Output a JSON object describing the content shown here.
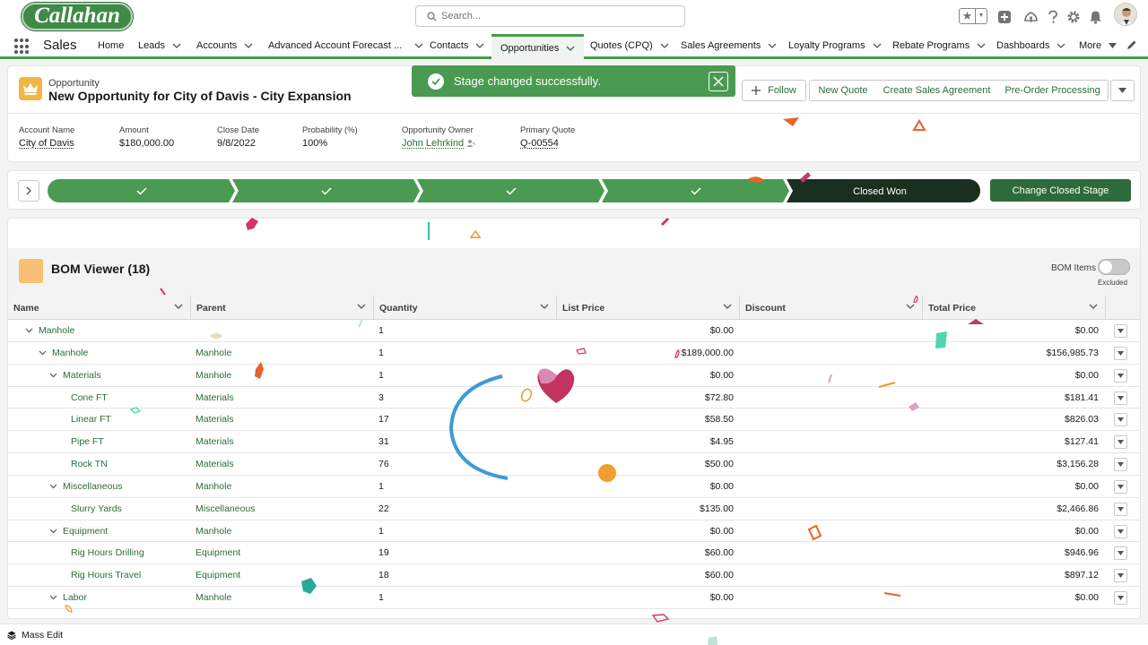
{
  "header": {
    "logo_text": "Callahan",
    "search_placeholder": "Search..."
  },
  "nav": {
    "app_name": "Sales",
    "items": [
      {
        "label": "Home",
        "dropdown": false
      },
      {
        "label": "Leads",
        "dropdown": true
      },
      {
        "label": "Accounts",
        "dropdown": true
      },
      {
        "label": "Advanced Account Forecast ...",
        "dropdown": true
      },
      {
        "label": "Contacts",
        "dropdown": true
      },
      {
        "label": "Opportunities",
        "dropdown": true,
        "active": true
      },
      {
        "label": "Quotes (CPQ)",
        "dropdown": true
      },
      {
        "label": "Sales Agreements",
        "dropdown": true
      },
      {
        "label": "Loyalty Programs",
        "dropdown": true
      },
      {
        "label": "Rebate Programs",
        "dropdown": true
      },
      {
        "label": "Dashboards",
        "dropdown": true
      },
      {
        "label": "More",
        "dropdown": true
      }
    ]
  },
  "record": {
    "object_label": "Opportunity",
    "title": "New Opportunity for City of Davis - City Expansion",
    "actions": {
      "follow": "Follow",
      "new_quote": "New Quote",
      "create_sales_agreement": "Create Sales Agreement",
      "pre_order": "Pre-Order Processing"
    },
    "fields": {
      "account_name": {
        "label": "Account Name",
        "value": "City of Davis"
      },
      "amount": {
        "label": "Amount",
        "value": "$180,000.00"
      },
      "close_date": {
        "label": "Close Date",
        "value": "9/8/2022"
      },
      "probability": {
        "label": "Probability (%)",
        "value": "100%"
      },
      "owner": {
        "label": "Opportunity Owner",
        "value": "John Lehrkind"
      },
      "primary_quote": {
        "label": "Primary Quote",
        "value": "Q-00554"
      }
    }
  },
  "toast": {
    "message": "Stage changed successfully."
  },
  "path": {
    "completed_steps": 4,
    "current_stage": "Closed Won",
    "change_button": "Change Closed Stage"
  },
  "bom": {
    "title": "BOM Viewer (18)",
    "toggle_label": "BOM Items",
    "toggle_state": "Excluded",
    "columns": {
      "name": "Name",
      "parent": "Parent",
      "quantity": "Quantity",
      "list_price": "List Price",
      "discount": "Discount",
      "total_price": "Total Price"
    },
    "rows": [
      {
        "name": "Manhole",
        "level": 0,
        "expanded": true,
        "parent": "",
        "quantity": "1",
        "list_price": "$0.00",
        "total_price": "$0.00"
      },
      {
        "name": "Manhole",
        "level": 1,
        "expanded": true,
        "parent": "Manhole",
        "quantity": "1",
        "list_price": "$189,000.00",
        "total_price": "$156,985.73"
      },
      {
        "name": "Materials",
        "level": 2,
        "expanded": true,
        "parent": "Manhole",
        "quantity": "1",
        "list_price": "$0.00",
        "total_price": "$0.00"
      },
      {
        "name": "Cone FT",
        "level": 3,
        "expanded": false,
        "parent": "Materials",
        "quantity": "3",
        "list_price": "$72.80",
        "total_price": "$181.41"
      },
      {
        "name": "Linear FT",
        "level": 3,
        "expanded": false,
        "parent": "Materials",
        "quantity": "17",
        "list_price": "$58.50",
        "total_price": "$826.03"
      },
      {
        "name": "Pipe FT",
        "level": 3,
        "expanded": false,
        "parent": "Materials",
        "quantity": "31",
        "list_price": "$4.95",
        "total_price": "$127.41"
      },
      {
        "name": "Rock TN",
        "level": 3,
        "expanded": false,
        "parent": "Materials",
        "quantity": "76",
        "list_price": "$50.00",
        "total_price": "$3,156.28"
      },
      {
        "name": "Miscellaneous",
        "level": 2,
        "expanded": true,
        "parent": "Manhole",
        "quantity": "1",
        "list_price": "$0.00",
        "total_price": "$0.00"
      },
      {
        "name": "Slurry Yards",
        "level": 3,
        "expanded": false,
        "parent": "Miscellaneous",
        "quantity": "22",
        "list_price": "$135.00",
        "total_price": "$2,466.86"
      },
      {
        "name": "Equipment",
        "level": 2,
        "expanded": true,
        "parent": "Manhole",
        "quantity": "1",
        "list_price": "$0.00",
        "total_price": "$0.00"
      },
      {
        "name": "Rig Hours Drilling",
        "level": 3,
        "expanded": false,
        "parent": "Equipment",
        "quantity": "19",
        "list_price": "$60.00",
        "total_price": "$946.96"
      },
      {
        "name": "Rig Hours Travel",
        "level": 3,
        "expanded": false,
        "parent": "Equipment",
        "quantity": "18",
        "list_price": "$60.00",
        "total_price": "$897.12"
      },
      {
        "name": "Labor",
        "level": 2,
        "expanded": true,
        "parent": "Manhole",
        "quantity": "1",
        "list_price": "$0.00",
        "total_price": "$0.00"
      }
    ]
  },
  "utility": {
    "mass_edit": "Mass Edit"
  },
  "colors": {
    "brand_green": "#4a9a52",
    "dark_green": "#2e6b3a",
    "closed_stage": "#1b2f21"
  }
}
